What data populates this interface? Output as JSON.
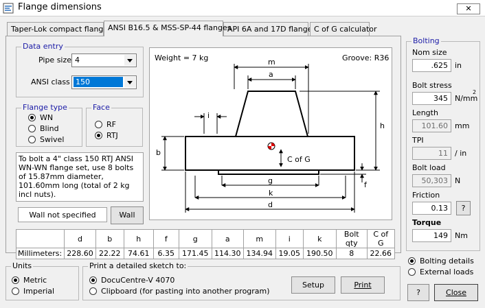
{
  "window": {
    "title": "Flange dimensions",
    "close_label": "✕"
  },
  "tabs": [
    {
      "label": "Taper-Lok compact flanges"
    },
    {
      "label": "ANSI B16.5 & MSS-SP-44 flanges"
    },
    {
      "label": "API 6A and 17D flanges"
    },
    {
      "label": "C of G calculator"
    }
  ],
  "data_entry": {
    "group_label": "Data entry",
    "pipe_size_label": "Pipe size",
    "pipe_size_value": "4",
    "ansi_class_label": "ANSI class",
    "ansi_class_value": "150"
  },
  "flange_type": {
    "group_label": "Flange type",
    "options": [
      {
        "label": "WN",
        "selected": true
      },
      {
        "label": "Blind",
        "selected": false
      },
      {
        "label": "Swivel",
        "selected": false
      }
    ]
  },
  "face": {
    "group_label": "Face",
    "options": [
      {
        "label": "RF",
        "selected": false
      },
      {
        "label": "RTJ",
        "selected": true
      }
    ]
  },
  "description": "To bolt a 4\" class 150 RTJ ANSI WN-WN flange set, use 8 bolts of 15.87mm diameter, 101.60mm long (total of 2 kg incl nuts).",
  "wall": {
    "status": "Wall not specified",
    "button_label": "Wall"
  },
  "diagram": {
    "weight": "Weight = 7 kg",
    "groove": "Groove: R36",
    "labels": {
      "m": "m",
      "a": "a",
      "h": "h",
      "i": "i",
      "b": "b",
      "cog": "C of G",
      "g": "g",
      "f": "f",
      "k": "k",
      "d": "d"
    }
  },
  "dimensions_table": {
    "headers": [
      "d",
      "b",
      "h",
      "f",
      "g",
      "a",
      "m",
      "i",
      "k",
      "Bolt qty",
      "C of G"
    ],
    "row_label": "Millimeters:",
    "values": [
      "228.60",
      "22.22",
      "74.61",
      "6.35",
      "171.45",
      "114.30",
      "134.94",
      "19.05",
      "190.50",
      "8",
      "22.66"
    ]
  },
  "units": {
    "group_label": "Units",
    "options": [
      {
        "label": "Metric",
        "selected": true
      },
      {
        "label": "Imperial",
        "selected": false
      }
    ]
  },
  "print": {
    "group_label": "Print a detailed sketch to:",
    "options": [
      {
        "label": "DocuCentre-V 4070",
        "selected": true
      },
      {
        "label": "Clipboard (for pasting into another program)",
        "selected": false
      }
    ],
    "setup_label": "Setup",
    "print_label": "Print"
  },
  "bolting": {
    "group_label": "Bolting",
    "nom_size": {
      "label": "Nom size",
      "value": ".625",
      "unit": "in"
    },
    "bolt_stress": {
      "label": "Bolt stress",
      "value": "345",
      "unit": "N/mm",
      "unit_sup": "2"
    },
    "length": {
      "label": "Length",
      "value": "101.60",
      "unit": "mm"
    },
    "tpi": {
      "label": "TPI",
      "value": "11",
      "unit": "/ in"
    },
    "bolt_load": {
      "label": "Bolt load",
      "value": "50,303",
      "unit": "N"
    },
    "friction": {
      "label": "Friction",
      "value": "0.13",
      "help_label": "?"
    },
    "torque": {
      "label": "Torque",
      "value": "149",
      "unit": "Nm"
    }
  },
  "mode": {
    "options": [
      {
        "label": "Bolting details",
        "selected": true
      },
      {
        "label": "External loads",
        "selected": false
      }
    ]
  },
  "footer": {
    "help_label": "?",
    "close_label": "Close"
  }
}
